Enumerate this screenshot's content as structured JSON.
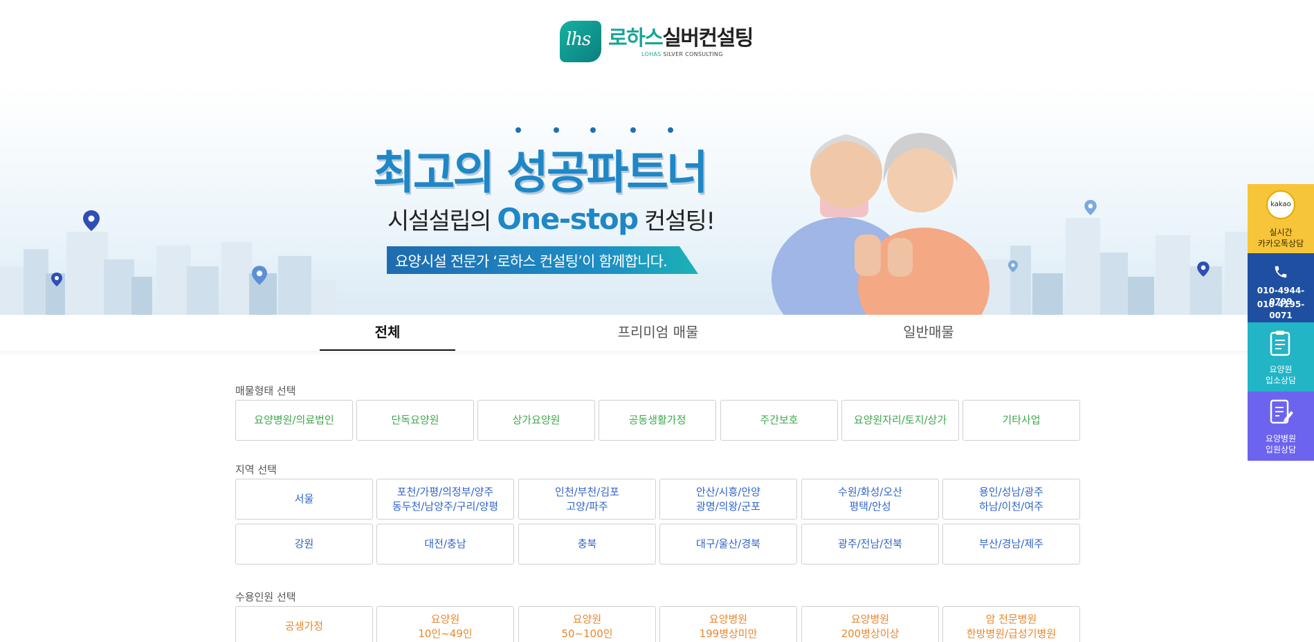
{
  "header": {
    "logo_mark": "lhs",
    "logo_title_teal": "로하스",
    "logo_title_dark": "실버컨설팅",
    "logo_sub_teal": "LOHAS",
    "logo_sub_dark": " SILVER CONSULTING"
  },
  "banner": {
    "headline": "최고의 성공파트너",
    "sub_prefix": "시설설립의 ",
    "sub_highlight": "One-stop",
    "sub_suffix": " 컨설팅!",
    "ribbon": "요양시설 전문가 ‘로하스 컨설팅’이 함께합니다."
  },
  "tabs": [
    {
      "label": "전체",
      "active": true
    },
    {
      "label": "프리미엄 매물",
      "active": false
    },
    {
      "label": "일반매물",
      "active": false
    }
  ],
  "filters": {
    "type_label": "매물형태 선택",
    "types": [
      "요양병원/의료법인",
      "단독요양원",
      "상가요양원",
      "공동생활가정",
      "주간보호",
      "요양원자리/토지/상가",
      "기타사업"
    ],
    "region_label": "지역 선택",
    "regions": [
      "서울",
      "포천/가평/의정부/양주\n동두천/남양주/구리/양평",
      "인천/부천/김포\n고양/파주",
      "안산/시흥/안양\n광명/의왕/군포",
      "수원/화성/오산\n평택/안성",
      "용인/성남/광주\n하남/이천/여주",
      "강원",
      "대전/충남",
      "충북",
      "대구/울산/경북",
      "광주/전남/전북",
      "부산/경남/제주"
    ],
    "capacity_label": "수용인원 선택",
    "capacities": [
      "공생가정",
      "요양원\n10인~49인",
      "요양원\n50~100인",
      "요양병원\n199병상미만",
      "요양병원\n200병상이상",
      "암 전문병원\n한방병원/급성기병원"
    ]
  },
  "side_menu": {
    "kakao_badge": "kakao",
    "kakao_line1": "실시간",
    "kakao_line2": "카카오톡상담",
    "phone1": "010-4944-0799",
    "phone2": "010-4195-0071",
    "care_line1": "요양원",
    "care_line2": "입소상담",
    "hosp_line1": "요양병원",
    "hosp_line2": "입원상담"
  },
  "colors": {
    "teal": "#1aa59a",
    "headline_blue": "#1f87c6",
    "type_green": "#3ca84a",
    "region_blue": "#2f63c8",
    "capacity_orange": "#e9862b",
    "kakao_yellow": "#f7c53a",
    "phone_navy": "#1f4fa0",
    "care_cyan": "#21b5c6",
    "hosp_purple": "#6c63ee"
  }
}
